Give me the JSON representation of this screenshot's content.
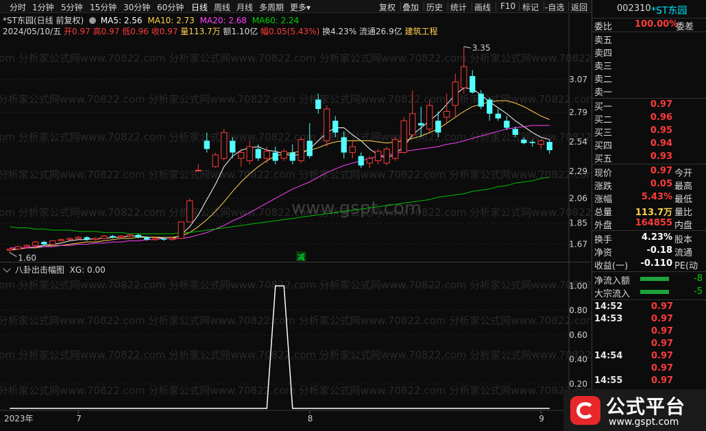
{
  "toolbar": {
    "periods": [
      "分时",
      "1分钟",
      "5分钟",
      "15分钟",
      "30分钟",
      "60分钟",
      "日线",
      "周线",
      "月线",
      "多周期",
      "更多"
    ],
    "active": "日线",
    "right_buttons": [
      "复权",
      "叠加",
      "历史",
      "统计",
      "画线",
      "F10",
      "标记",
      "-自选",
      "返回"
    ],
    "more_arrow": "▾"
  },
  "chart_header": {
    "title": "*ST东园(日线 前复权)",
    "ma5": "MA5: 2.56",
    "ma10": "MA10: 2.73",
    "ma20": "MA20: 2.68",
    "ma60": "MA60: 2.24",
    "info_date": "2024/05/10/五",
    "open": "开0.97",
    "high": "高0.97",
    "low": "低0.96",
    "close": "收0.97",
    "volume": "量113.7万",
    "amount": "额1.10亿",
    "change": "幅0.05(5.43%)",
    "turnover": "换4.23%",
    "float": "流通26.9亿",
    "sector": "建筑工程"
  },
  "watermarks": {
    "line": "com 分析家公式网www.70822.com 分析家公式网www.70822.com 分析家公式网www.70822.com 分析家公式网www.70822.com",
    "center": "www.gspt.com"
  },
  "chart_data": [
    {
      "type": "candlestick",
      "title": "*ST东园(日线 前复权)",
      "y_ticks": [
        3.07,
        2.79,
        2.54,
        2.29,
        2.06,
        1.85,
        1.67
      ],
      "y_tick_labels": [
        "3.07",
        "2.79",
        "2.54",
        "2.29",
        "2.06",
        "1.85",
        "1.67"
      ],
      "ylim": [
        1.58,
        3.42
      ],
      "annotations": {
        "high": "3.35",
        "low": "1.60",
        "marker": "减"
      },
      "x_labels": [
        "2023年",
        "7",
        "8",
        "9"
      ],
      "x_label_index": [
        0,
        8,
        35,
        62
      ],
      "candles": [
        [
          1.62,
          1.64,
          1.6,
          1.63
        ],
        [
          1.63,
          1.66,
          1.62,
          1.65
        ],
        [
          1.65,
          1.67,
          1.64,
          1.66
        ],
        [
          1.66,
          1.7,
          1.65,
          1.69
        ],
        [
          1.69,
          1.7,
          1.66,
          1.67
        ],
        [
          1.67,
          1.7,
          1.67,
          1.7
        ],
        [
          1.7,
          1.72,
          1.69,
          1.71
        ],
        [
          1.71,
          1.73,
          1.7,
          1.72
        ],
        [
          1.72,
          1.74,
          1.71,
          1.73
        ],
        [
          1.73,
          1.74,
          1.7,
          1.71
        ],
        [
          1.71,
          1.73,
          1.7,
          1.72
        ],
        [
          1.72,
          1.75,
          1.71,
          1.74
        ],
        [
          1.74,
          1.75,
          1.72,
          1.73
        ],
        [
          1.73,
          1.75,
          1.72,
          1.74
        ],
        [
          1.74,
          1.76,
          1.73,
          1.75
        ],
        [
          1.75,
          1.76,
          1.72,
          1.73
        ],
        [
          1.73,
          1.74,
          1.7,
          1.71
        ],
        [
          1.71,
          1.73,
          1.7,
          1.72
        ],
        [
          1.72,
          1.73,
          1.7,
          1.71
        ],
        [
          1.71,
          1.73,
          1.7,
          1.72
        ],
        [
          1.72,
          1.86,
          1.72,
          1.86
        ],
        [
          1.86,
          2.06,
          1.86,
          2.04
        ],
        [
          2.3,
          2.35,
          2.29,
          2.3
        ],
        [
          2.55,
          2.62,
          2.45,
          2.48
        ],
        [
          2.33,
          2.45,
          2.32,
          2.43
        ],
        [
          2.4,
          2.65,
          2.38,
          2.62
        ],
        [
          2.55,
          2.58,
          2.4,
          2.45
        ],
        [
          2.4,
          2.48,
          2.33,
          2.45
        ],
        [
          2.38,
          2.55,
          2.35,
          2.5
        ],
        [
          2.48,
          2.52,
          2.38,
          2.4
        ],
        [
          2.4,
          2.5,
          2.36,
          2.46
        ],
        [
          2.45,
          2.5,
          2.35,
          2.38
        ],
        [
          2.4,
          2.48,
          2.38,
          2.46
        ],
        [
          2.45,
          2.52,
          2.35,
          2.38
        ],
        [
          2.38,
          2.58,
          2.36,
          2.56
        ],
        [
          2.55,
          2.7,
          2.4,
          2.42
        ],
        [
          2.9,
          2.95,
          2.78,
          2.82
        ],
        [
          2.55,
          2.85,
          2.5,
          2.82
        ],
        [
          2.72,
          2.76,
          2.58,
          2.62
        ],
        [
          2.58,
          2.63,
          2.4,
          2.45
        ],
        [
          2.45,
          2.55,
          2.4,
          2.5
        ],
        [
          2.42,
          2.45,
          2.32,
          2.34
        ],
        [
          2.36,
          2.42,
          2.32,
          2.4
        ],
        [
          2.38,
          2.48,
          2.35,
          2.46
        ],
        [
          2.36,
          2.5,
          2.34,
          2.48
        ],
        [
          2.4,
          2.58,
          2.38,
          2.56
        ],
        [
          2.45,
          2.75,
          2.44,
          2.72
        ],
        [
          2.6,
          2.98,
          2.58,
          2.78
        ],
        [
          2.7,
          2.84,
          2.58,
          2.68
        ],
        [
          2.65,
          2.9,
          2.62,
          2.85
        ],
        [
          2.72,
          2.8,
          2.58,
          2.62
        ],
        [
          2.75,
          2.95,
          2.7,
          2.8
        ],
        [
          2.85,
          3.12,
          2.75,
          3.05
        ],
        [
          3.0,
          3.35,
          2.95,
          3.18
        ],
        [
          3.1,
          3.15,
          2.95,
          2.96
        ],
        [
          2.95,
          2.98,
          2.82,
          2.84
        ],
        [
          2.9,
          2.92,
          2.72,
          2.78
        ],
        [
          2.78,
          2.82,
          2.72,
          2.74
        ],
        [
          2.72,
          2.76,
          2.64,
          2.66
        ],
        [
          2.65,
          2.67,
          2.58,
          2.6
        ],
        [
          2.56,
          2.58,
          2.52,
          2.53
        ],
        [
          2.54,
          2.56,
          2.5,
          2.53
        ],
        [
          2.52,
          2.56,
          2.48,
          2.55
        ],
        [
          2.54,
          2.56,
          2.44,
          2.47
        ]
      ],
      "series": [
        {
          "name": "MA5",
          "color": "#ffffff",
          "values": [
            1.62,
            1.63,
            1.64,
            1.65,
            1.66,
            1.67,
            1.68,
            1.7,
            1.71,
            1.71,
            1.72,
            1.72,
            1.73,
            1.73,
            1.74,
            1.74,
            1.73,
            1.73,
            1.72,
            1.72,
            1.75,
            1.82,
            1.92,
            2.05,
            2.18,
            2.33,
            2.42,
            2.47,
            2.49,
            2.5,
            2.47,
            2.46,
            2.44,
            2.42,
            2.44,
            2.48,
            2.55,
            2.62,
            2.66,
            2.66,
            2.6,
            2.55,
            2.48,
            2.43,
            2.4,
            2.44,
            2.5,
            2.6,
            2.66,
            2.72,
            2.78,
            2.86,
            2.94,
            3.0,
            2.99,
            2.94,
            2.88,
            2.83,
            2.78,
            2.72,
            2.67,
            2.62,
            2.58,
            2.56
          ]
        },
        {
          "name": "MA10",
          "color": "#ffd24c",
          "values": [
            1.63,
            1.63,
            1.64,
            1.64,
            1.65,
            1.66,
            1.66,
            1.67,
            1.68,
            1.69,
            1.69,
            1.7,
            1.71,
            1.72,
            1.72,
            1.73,
            1.73,
            1.73,
            1.73,
            1.73,
            1.74,
            1.77,
            1.82,
            1.88,
            1.95,
            2.03,
            2.12,
            2.2,
            2.27,
            2.33,
            2.38,
            2.42,
            2.44,
            2.45,
            2.46,
            2.47,
            2.49,
            2.52,
            2.54,
            2.55,
            2.55,
            2.55,
            2.55,
            2.54,
            2.53,
            2.54,
            2.55,
            2.57,
            2.59,
            2.62,
            2.65,
            2.7,
            2.75,
            2.8,
            2.84,
            2.86,
            2.88,
            2.89,
            2.89,
            2.87,
            2.84,
            2.8,
            2.76,
            2.73
          ]
        },
        {
          "name": "MA20",
          "color": "#ff40ff",
          "values": [
            1.64,
            1.64,
            1.64,
            1.65,
            1.65,
            1.65,
            1.66,
            1.66,
            1.67,
            1.67,
            1.68,
            1.68,
            1.69,
            1.69,
            1.7,
            1.7,
            1.71,
            1.71,
            1.72,
            1.72,
            1.72,
            1.73,
            1.75,
            1.77,
            1.8,
            1.83,
            1.87,
            1.9,
            1.94,
            1.98,
            2.02,
            2.06,
            2.1,
            2.14,
            2.17,
            2.2,
            2.24,
            2.28,
            2.31,
            2.34,
            2.36,
            2.38,
            2.4,
            2.42,
            2.43,
            2.44,
            2.46,
            2.47,
            2.48,
            2.49,
            2.5,
            2.52,
            2.53,
            2.55,
            2.57,
            2.59,
            2.61,
            2.63,
            2.65,
            2.66,
            2.67,
            2.68,
            2.68,
            2.68
          ]
        },
        {
          "name": "MA60",
          "color": "#00c000",
          "values": [
            1.82,
            1.81,
            1.81,
            1.8,
            1.8,
            1.79,
            1.79,
            1.79,
            1.78,
            1.78,
            1.78,
            1.77,
            1.77,
            1.77,
            1.76,
            1.76,
            1.76,
            1.76,
            1.76,
            1.76,
            1.77,
            1.77,
            1.78,
            1.79,
            1.8,
            1.81,
            1.82,
            1.83,
            1.84,
            1.85,
            1.86,
            1.87,
            1.88,
            1.89,
            1.9,
            1.91,
            1.92,
            1.93,
            1.94,
            1.95,
            1.96,
            1.97,
            1.98,
            1.99,
            2.0,
            2.01,
            2.02,
            2.03,
            2.04,
            2.05,
            2.07,
            2.08,
            2.09,
            2.1,
            2.12,
            2.13,
            2.14,
            2.16,
            2.17,
            2.19,
            2.2,
            2.21,
            2.23,
            2.24
          ]
        }
      ]
    },
    {
      "type": "line",
      "title": "八卦出击幅图",
      "series_label": "XG: 0.00",
      "y_ticks": [
        1.0,
        0.8,
        0.6,
        0.4,
        0.2
      ],
      "y_tick_labels": [
        "1.00",
        "0.80",
        "0.60",
        "0.40",
        "0.20"
      ],
      "ylim": [
        0,
        1.08
      ],
      "series": [
        {
          "name": "XG",
          "color": "#ffffff",
          "values": [
            0,
            0,
            0,
            0,
            0,
            0,
            0,
            0,
            0,
            0,
            0,
            0,
            0,
            0,
            0,
            0,
            0,
            0,
            0,
            0,
            0,
            0,
            0,
            0,
            0,
            0,
            0,
            0,
            0,
            0,
            0,
            1,
            1,
            0,
            0,
            0,
            0,
            0,
            0,
            0,
            0,
            0,
            0,
            0,
            0,
            0,
            0,
            0,
            0,
            0,
            0,
            0,
            0,
            0,
            0,
            0,
            0,
            0,
            0,
            0,
            0,
            0,
            0,
            0
          ]
        }
      ]
    }
  ],
  "quote": {
    "code": "002310",
    "name": "*ST东园",
    "weibi_label": "委比",
    "weibi_value": "100.00%",
    "weicha_label": "委差",
    "asks": [
      {
        "label": "卖五",
        "price": ""
      },
      {
        "label": "卖四",
        "price": ""
      },
      {
        "label": "卖三",
        "price": ""
      },
      {
        "label": "卖二",
        "price": ""
      },
      {
        "label": "卖一",
        "price": ""
      }
    ],
    "bids": [
      {
        "label": "买一",
        "price": "0.97"
      },
      {
        "label": "买二",
        "price": "0.96"
      },
      {
        "label": "买三",
        "price": "0.95"
      },
      {
        "label": "买四",
        "price": "0.94"
      },
      {
        "label": "买五",
        "price": "0.93"
      }
    ],
    "stats": [
      {
        "label": "现价",
        "value": "0.97",
        "color": "#ff3b3b",
        "label2": "今开"
      },
      {
        "label": "涨跌",
        "value": "0.05",
        "color": "#ff3b3b",
        "label2": "最高"
      },
      {
        "label": "涨幅",
        "value": "5.43%",
        "color": "#ff3b3b",
        "label2": "最低"
      },
      {
        "label": "总量",
        "value": "113.7万",
        "color": "#ffd24c",
        "label2": "量比"
      },
      {
        "label": "外盘",
        "value": "164855",
        "color": "#ff3b3b",
        "label2": "内盘"
      }
    ],
    "stats2": [
      {
        "label": "换手",
        "value": "4.23%",
        "color": "#ffffff",
        "label2": "股本"
      },
      {
        "label": "净资",
        "value": "-0.18",
        "color": "#ffffff",
        "label2": "流通"
      },
      {
        "label": "收益(一)",
        "value": "-0.110",
        "color": "#ffffff",
        "label2": "PE(动"
      }
    ],
    "flows": [
      {
        "label": "净流入额",
        "value": "-8",
        "bar": 0.75
      },
      {
        "label": "大宗流入",
        "value": "-5",
        "bar": 0.75
      }
    ],
    "ticks": [
      {
        "time": "14:52",
        "price": "0.97"
      },
      {
        "time": "14:53",
        "price": "0.97"
      },
      {
        "time": "",
        "price": "0.97"
      },
      {
        "time": "",
        "price": "0.97"
      },
      {
        "time": "14:54",
        "price": "0.97"
      },
      {
        "time": "",
        "price": "0.97"
      },
      {
        "time": "14:55",
        "price": "0.97"
      }
    ]
  },
  "brand": {
    "text": "公式平台",
    "url": "www.gspt.com"
  }
}
